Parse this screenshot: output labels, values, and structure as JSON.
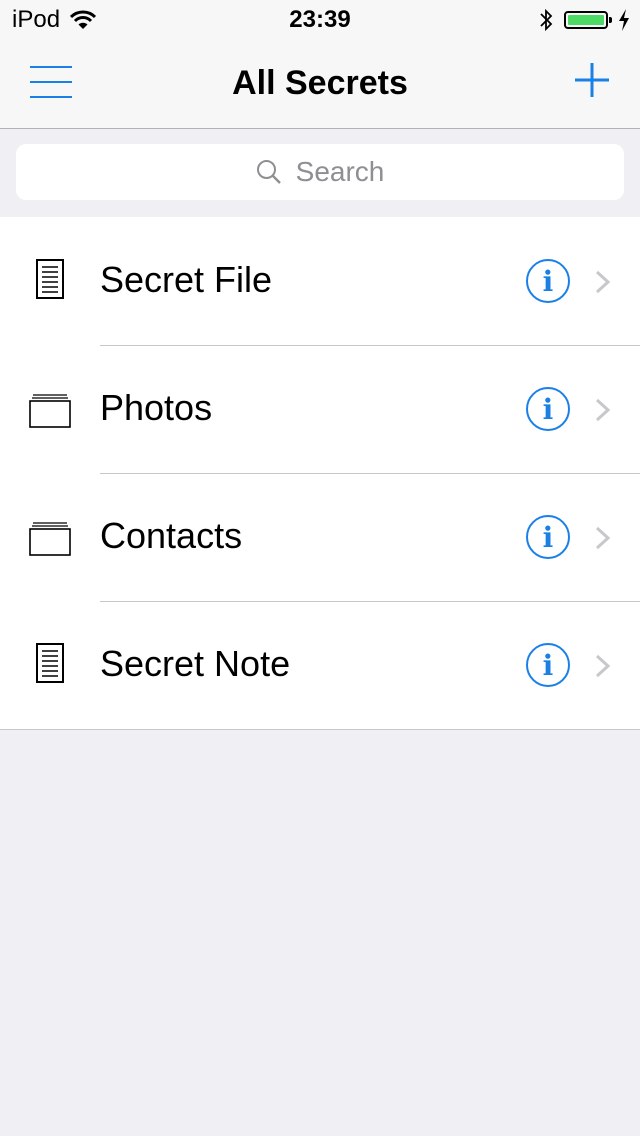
{
  "status": {
    "carrier": "iPod",
    "time": "23:39",
    "battery_level": 1.0
  },
  "nav": {
    "title": "All Secrets"
  },
  "search": {
    "placeholder": "Search"
  },
  "items": [
    {
      "label": "Secret File",
      "icon": "document-icon"
    },
    {
      "label": "Photos",
      "icon": "folder-icon"
    },
    {
      "label": "Contacts",
      "icon": "folder-icon"
    },
    {
      "label": "Secret Note",
      "icon": "document-icon"
    }
  ],
  "info_glyph": "i",
  "colors": {
    "accent": "#1a80e5",
    "battery": "#4cd964",
    "background": "#efeff4"
  }
}
